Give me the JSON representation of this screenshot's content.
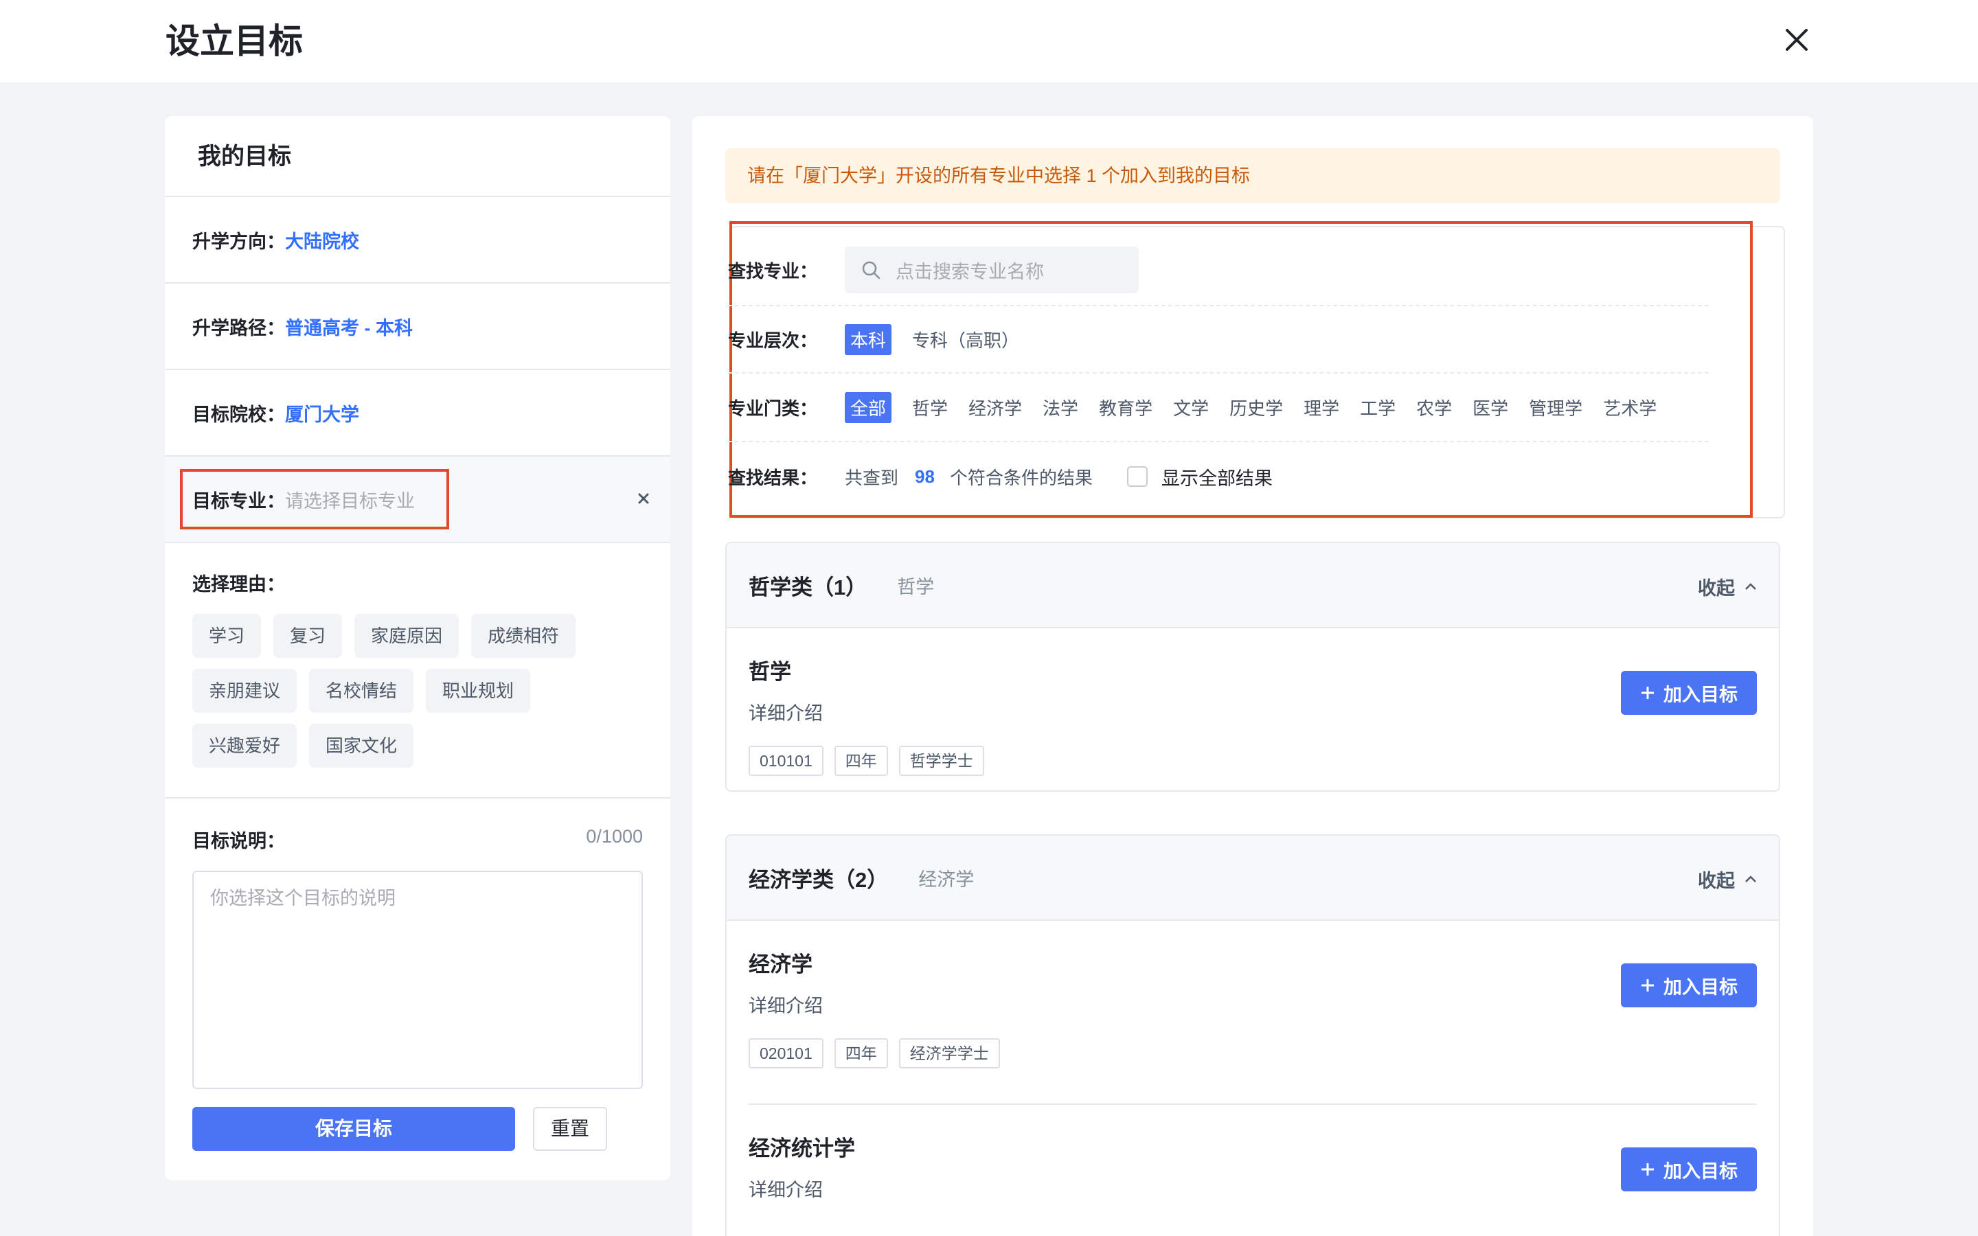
{
  "header": {
    "title": "设立目标"
  },
  "left": {
    "title": "我的目标",
    "direction": {
      "label": "升学方向：",
      "value": "大陆院校"
    },
    "path": {
      "label": "升学路径：",
      "value": "普通高考 - 本科"
    },
    "school": {
      "label": "目标院校：",
      "value": "厦门大学"
    },
    "major": {
      "label": "目标专业：",
      "placeholder": "请选择目标专业"
    },
    "reasons": {
      "label": "选择理由：",
      "tags": [
        "学习",
        "复习",
        "家庭原因",
        "成绩相符",
        "亲朋建议",
        "名校情结",
        "职业规划",
        "兴趣爱好",
        "国家文化"
      ]
    },
    "description": {
      "label": "目标说明：",
      "counter": "0/1000",
      "placeholder": "你选择这个目标的说明"
    },
    "save_label": "保存目标",
    "reset_label": "重置"
  },
  "right": {
    "notice": "请在「厦门大学」开设的所有专业中选择 1 个加入到我的目标",
    "search": {
      "label": "查找专业：",
      "placeholder": "点击搜索专业名称"
    },
    "level": {
      "label": "专业层次：",
      "options": [
        "本科",
        "专科（高职）"
      ],
      "selected": "本科"
    },
    "category": {
      "label": "专业门类：",
      "options": [
        "全部",
        "哲学",
        "经济学",
        "法学",
        "教育学",
        "文学",
        "历史学",
        "理学",
        "工学",
        "农学",
        "医学",
        "管理学",
        "艺术学"
      ],
      "selected": "全部"
    },
    "result": {
      "label": "查找结果：",
      "prefix": "共查到",
      "count": "98",
      "suffix": "个符合条件的结果",
      "show_all": "显示全部结果"
    },
    "groups": [
      {
        "title": "哲学类（1）",
        "subtitle": "哲学",
        "collapse_label": "收起",
        "items": [
          {
            "name": "哲学",
            "detail": "详细介绍",
            "code": "010101",
            "years": "四年",
            "degree": "哲学学士",
            "add_label": "加入目标"
          }
        ]
      },
      {
        "title": "经济学类（2）",
        "subtitle": "经济学",
        "collapse_label": "收起",
        "items": [
          {
            "name": "经济学",
            "detail": "详细介绍",
            "code": "020101",
            "years": "四年",
            "degree": "经济学学士",
            "add_label": "加入目标"
          },
          {
            "name": "经济统计学",
            "detail": "详细介绍",
            "add_label": "加入目标"
          }
        ]
      }
    ]
  },
  "colors": {
    "accent": "#4b74f5",
    "link": "#3370ff",
    "highlight_border": "#e34a2d",
    "notice_bg": "#fff3e2",
    "notice_text": "#c65a0a"
  }
}
